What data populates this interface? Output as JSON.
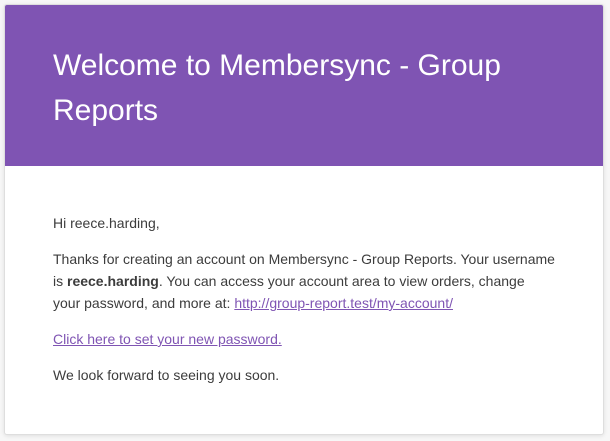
{
  "email": {
    "heading": "Welcome to Membersync - Group Reports",
    "greeting": "Hi reece.harding,",
    "intro": {
      "text_before_username": "Thanks for creating an account on Membersync - Group Reports. Your username is ",
      "username": "reece.harding",
      "text_after_username": ". You can access your account area to view orders, change your password, and more at: ",
      "account_link": "http://group-report.test/my-account/"
    },
    "set_password_link": "Click here to set your new password.",
    "closing": "We look forward to seeing you soon."
  },
  "colors": {
    "header_background": "#7f54b3",
    "header_text": "#ffffff",
    "body_text": "#3c3c3c",
    "link": "#7f54b3"
  }
}
